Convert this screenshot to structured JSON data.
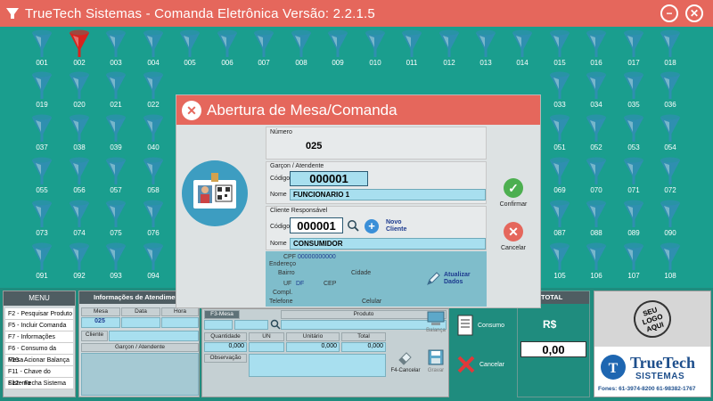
{
  "window": {
    "title": "TrueTech Sistemas - Comanda Eletrônica  Versão: 2.2.1.5",
    "minimize_label": "−",
    "close_label": "✕"
  },
  "tables": {
    "row1": [
      "001",
      "002",
      "003",
      "004",
      "005",
      "006",
      "007",
      "008",
      "009",
      "010",
      "011",
      "012",
      "013",
      "014",
      "015",
      "016",
      "017",
      "018"
    ],
    "row2": [
      "019",
      "020",
      "021",
      "022",
      "033",
      "034",
      "035",
      "036"
    ],
    "row3": [
      "037",
      "038",
      "039",
      "040",
      "051",
      "052",
      "053",
      "054"
    ],
    "row4": [
      "055",
      "056",
      "057",
      "058",
      "069",
      "070",
      "071",
      "072"
    ],
    "row5": [
      "073",
      "074",
      "075",
      "076",
      "087",
      "088",
      "089",
      "090"
    ],
    "row6": [
      "091",
      "092",
      "093",
      "094",
      "105",
      "106",
      "107",
      "108"
    ],
    "occupied": [
      "002"
    ],
    "free_color": "#2f8fb0",
    "occupied_color": "#d8231e"
  },
  "modal": {
    "title": "Abertura de Mesa/Comanda",
    "numero_label": "Número",
    "numero_value": "025",
    "garcom_section": "Garçon / Atendente",
    "codigo_label": "Código",
    "garcom_codigo": "000001",
    "nome_label": "Nome",
    "garcom_nome": "FUNCIONARIO 1",
    "cliente_section": "Cliente Responsável",
    "cliente_codigo": "000001",
    "novo_cliente_label": "Novo Cliente",
    "cliente_nome": "CONSUMIDOR",
    "addr": {
      "cpf_label": "CPF",
      "cpf_value": "00000000000",
      "endereco_label": "Endereço",
      "bairro_label": "Bairro",
      "cidade_label": "Cidade",
      "uf_label": "UF",
      "uf_value": "DF",
      "cep_label": "CEP",
      "compl_label": "Compl.",
      "telefone_label": "Telefone",
      "celular_label": "Celular",
      "atualizar_label": "Atualizar Dados"
    },
    "confirmar_label": "Confirmar",
    "cancelar_label": "Cancelar"
  },
  "menu": {
    "title": "MENU",
    "items": [
      "F2 - Pesquisar Produto",
      "F5 - Incluir Comanda",
      "F7 - Informações",
      "F6 - Consumo da Mesa",
      "F10 - Acionar Balança",
      "F11 - Chave do Sistema",
      "F12 - Fecha Sistema"
    ]
  },
  "info": {
    "title": "Informações de Atendiment",
    "mesa_label": "Mesa",
    "data_label": "Data",
    "hora_label": "Hora",
    "mesa_value": "025",
    "cliente_label": "Cliente",
    "garcom_label": "Garçon / Atendente"
  },
  "product": {
    "f3_label": "F3-Mesa",
    "produto_label": "Produto",
    "quantidade_label": "Quantidade",
    "un_label": "UN",
    "unitario_label": "Unitário",
    "total_label": "Total",
    "quantidade_value": "0,000",
    "unitario_value": "0,000",
    "total_value": "0,000",
    "observacao_label": "Observação",
    "balanca_label": "Balança",
    "f4_cancelar_label": "F4-Cancelar",
    "gravar_label": "Gravar"
  },
  "actions": {
    "consumo_label": "Consumo",
    "cancelar_label": "Cancelar"
  },
  "total": {
    "title": "TOTAL",
    "currency": "R$",
    "value": "0,00"
  },
  "brand": {
    "logo_text": "SEU LOGO AQUI",
    "name": "TrueTech",
    "sub": "SISTEMAS",
    "phones": "Fones: 61-3974-8200  61-98382-1767"
  }
}
